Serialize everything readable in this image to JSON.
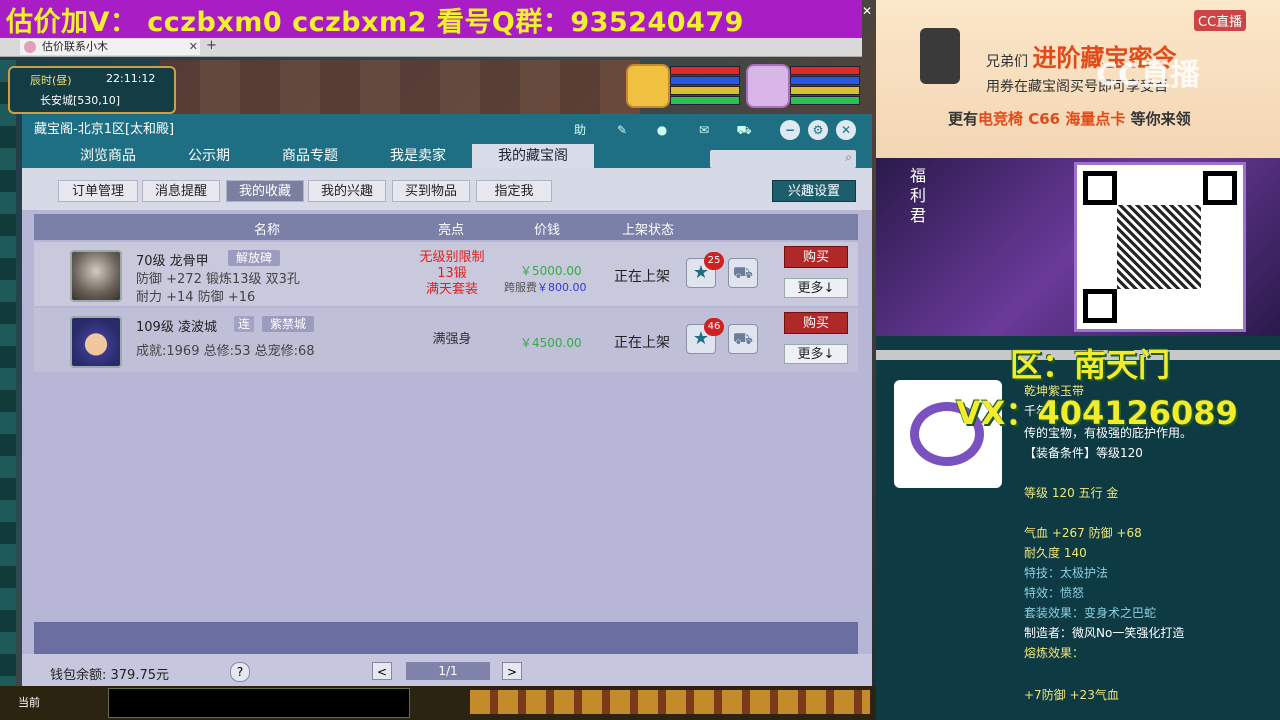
{
  "banner": {
    "text": "估价加V：  cczbxm0   cczbxm2   看号Q群：935240479",
    "close": "✕"
  },
  "browser": {
    "tab_title": "估价联系小木",
    "tab_close": "✕",
    "new_tab": "+"
  },
  "hud": {
    "period": "辰时(昼)",
    "time": "22:11:12",
    "location": "长安城[530,10]"
  },
  "dialog": {
    "title": "藏宝阁-北京1区[太和殿]",
    "controls": {
      "help": "助",
      "close": "✕"
    },
    "tabs": [
      {
        "label": "浏览商品"
      },
      {
        "label": "公示期"
      },
      {
        "label": "商品专题"
      },
      {
        "label": "我是卖家"
      },
      {
        "label": "我的藏宝阁"
      }
    ],
    "search": {
      "placeholder": ""
    },
    "subtabs": [
      {
        "label": "订单管理"
      },
      {
        "label": "消息提醒"
      },
      {
        "label": "我的收藏"
      },
      {
        "label": "我的兴趣"
      },
      {
        "label": "买到物品"
      },
      {
        "label": "指定我"
      }
    ],
    "interest_button": "兴趣设置",
    "columns": {
      "name": "名称",
      "highlight": "亮点",
      "price": "价钱",
      "status": "上架状态"
    },
    "rows": [
      {
        "level_name": "70级  龙骨甲",
        "tag": "解放碑",
        "line2": "防御 +272  锻炼13级  双3孔",
        "line3": "耐力 +14  防御 +16",
        "highlight": [
          "无级别限制",
          "13锻",
          "满天套装"
        ],
        "price": "￥5000.00",
        "fee_label": "跨服费",
        "fee_value": "￥800.00",
        "status": "正在上架",
        "fav_count": "25",
        "buy": "购买",
        "more": "更多↓"
      },
      {
        "level_name": "109级  凌波城",
        "tag_small": "连",
        "tag": "紫禁城",
        "line2": "成就:1969  总修:53  总宠修:68",
        "highlight": [
          "满强身"
        ],
        "price": "￥4500.00",
        "status": "正在上架",
        "fav_count": "46",
        "buy": "购买",
        "more": "更多↓"
      }
    ],
    "wallet": "钱包余额: 379.75元",
    "help_icon": "?",
    "page": {
      "prev": "<",
      "current": "1/1",
      "next": ">"
    }
  },
  "bottom": {
    "current": "当前"
  },
  "ad": {
    "line1_a": "兄弟们",
    "line1_b": "进阶藏宝密令",
    "line2": "用券在藏宝阁买号即可享受百",
    "line3_a": "更有",
    "line3_b": "电竞椅 C66 海量点卡",
    "line3_c": "等你来领",
    "logo": "CC直播",
    "watermark": "CC直播"
  },
  "promo": {
    "label": "福利君"
  },
  "overlay": {
    "region": "区：南天门",
    "vx": "VX：404126089"
  },
  "item": {
    "name": "乾坤紫玉带",
    "desc1": "千年",
    "desc2": "传的宝物，有极强的庇护作用。",
    "req": "【装备条件】等级120",
    "level": "等级 120 五行 金",
    "stats": "气血 +267 防御 +68",
    "durability": "耐久度 140",
    "skill": "特技：太极护法",
    "effect": "特效：愤怒",
    "set": "套装效果：变身术之巴蛇",
    "maker": "制造者：微风No一笑强化打造",
    "melt": "熔炼效果：",
    "melt_val": "+7防御 +23气血"
  },
  "colors": {
    "accent": "#1f6f84",
    "buy": "#b02828",
    "banner": "#a81ec4",
    "banner_text": "#f2f02c"
  }
}
